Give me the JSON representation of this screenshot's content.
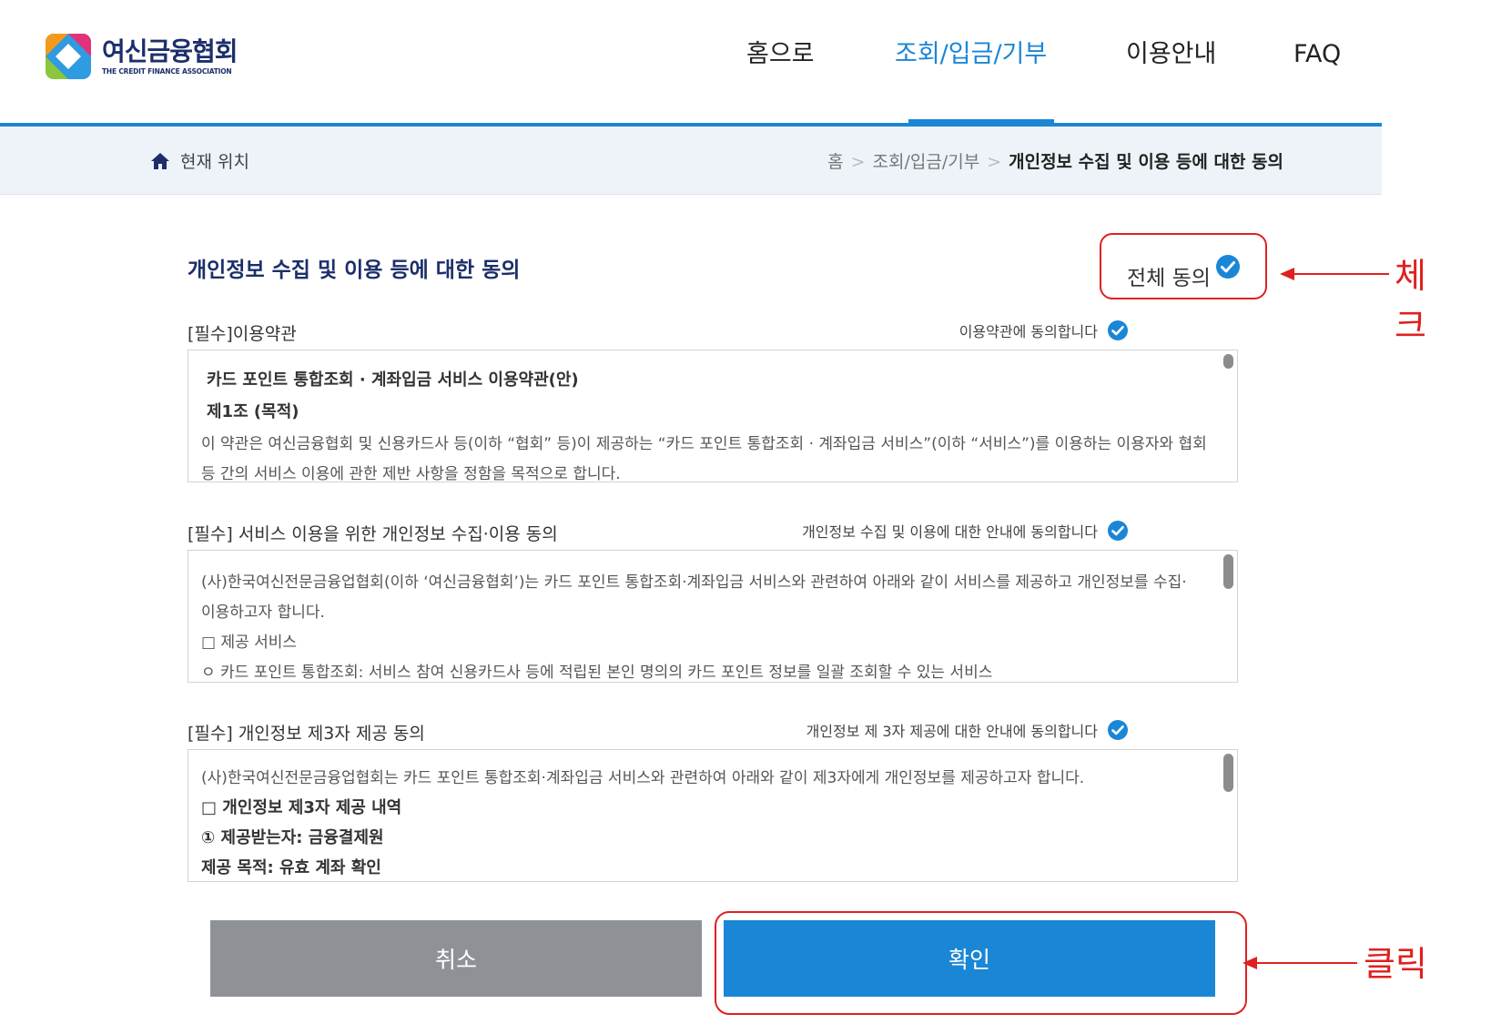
{
  "header": {
    "logo_name": "여신금융협회",
    "logo_sub": "THE CREDIT FINANCE ASSOCIATION",
    "nav": [
      {
        "label": "홈으로",
        "active": false
      },
      {
        "label": "조회/입금/기부",
        "active": true
      },
      {
        "label": "이용안내",
        "active": false
      },
      {
        "label": "FAQ",
        "active": false
      }
    ]
  },
  "breadcrumb": {
    "location_label": "현재 위치",
    "items": [
      "홈",
      "조회/입금/기부",
      "개인정보 수집 및 이용 등에 대한 동의"
    ]
  },
  "main": {
    "title": "개인정보 수집 및 이용 등에 대한 동의",
    "agree_all_label": "전체 동의",
    "sections": [
      {
        "label": "[필수]이용약관",
        "agree_text": "이용약관에 동의합니다",
        "lines": [
          "카드 포인트 통합조회 · 계좌입금 서비스 이용약관(안)",
          "제1조 (목적)",
          "이 약관은 여신금융협회 및 신용카드사 등(이하 “협회” 등)이 제공하는 “카드 포인트 통합조회 · 계좌입금 서비스”(이하 “서비스”)를 이용하는 이용자와 협회",
          "등 간의 서비스 이용에 관한 제반 사항을 정함을 목적으로 합니다."
        ]
      },
      {
        "label": "[필수] 서비스 이용을 위한 개인정보 수집·이용 동의",
        "agree_text": "개인정보 수집 및 이용에 대한 안내에 동의합니다",
        "lines": [
          "(사)한국여신전문금융업협회(이하 ‘여신금융협회’)는 카드 포인트 통합조회·계좌입금 서비스와 관련하여 아래와 같이 서비스를 제공하고 개인정보를 수집·",
          "이용하고자 합니다.",
          "□ 제공 서비스",
          "ㅇ 카드 포인트 통합조회: 서비스 참여 신용카드사 등에 적립된 본인 명의의 카드 포인트 정보를 일괄 조회할 수 있는 서비스"
        ]
      },
      {
        "label": "[필수] 개인정보 제3자 제공 동의",
        "agree_text": "개인정보 제 3자 제공에 대한 안내에 동의합니다",
        "lines": [
          "(사)한국여신전문금융업협회는 카드 포인트 통합조회·계좌입금 서비스와 관련하여 아래와 같이 제3자에게 개인정보를 제공하고자 합니다.",
          "□ 개인정보 제3자 제공 내역",
          "① 제공받는자: 금융결제원",
          "제공 목적: 유효 계좌 확인"
        ]
      }
    ]
  },
  "buttons": {
    "cancel_label": "취소",
    "confirm_label": "확인"
  },
  "annotations": {
    "check_label": "체크",
    "click_label": "클릭"
  },
  "colors": {
    "accent": "#1a86d6",
    "title_navy": "#1c2f6b",
    "annotation_red": "#e02020",
    "cancel_gray": "#8e9297"
  }
}
